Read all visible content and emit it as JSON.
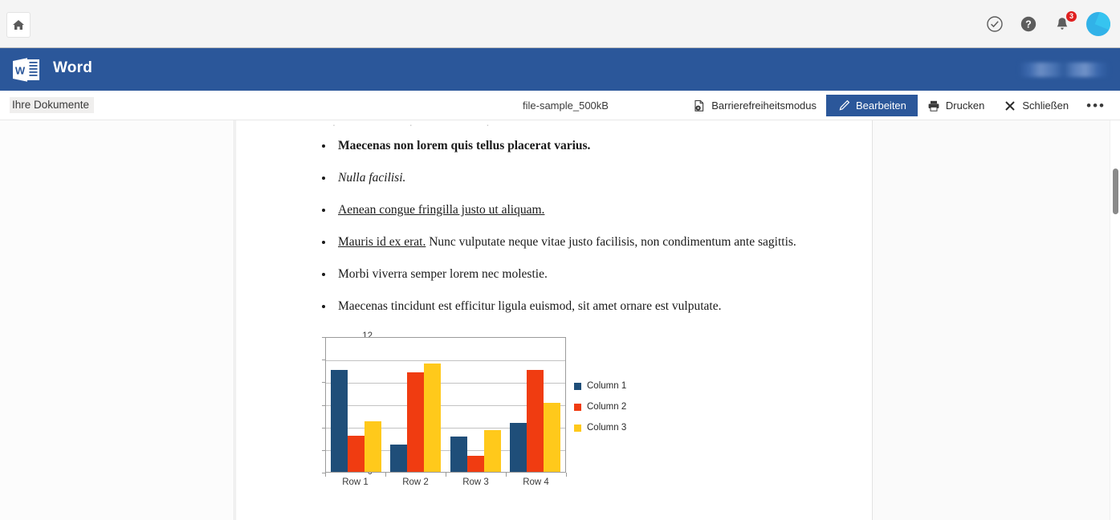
{
  "chrome": {
    "home_icon": "home-icon",
    "icons": [
      {
        "name": "check-circle-icon",
        "glyph": "check"
      },
      {
        "name": "help-circle-icon",
        "glyph": "question"
      },
      {
        "name": "notification-bell-icon",
        "glyph": "bell",
        "badge": "3"
      }
    ],
    "avatar": "user-avatar"
  },
  "header": {
    "app_name": "Word",
    "logo_letter": "W"
  },
  "command_bar": {
    "breadcrumb": "Ihre Dokumente",
    "document_name": "file-sample_500kB",
    "actions": [
      {
        "name": "accessibility-mode-button",
        "label": "Barrierefreiheitsmodus",
        "icon": "accessibility-doc-icon",
        "primary": false
      },
      {
        "name": "edit-button",
        "label": "Bearbeiten",
        "icon": "pencil-icon",
        "primary": true
      },
      {
        "name": "print-button",
        "label": "Drucken",
        "icon": "printer-icon",
        "primary": false
      },
      {
        "name": "close-button",
        "label": "Schließen",
        "icon": "close-icon",
        "primary": false
      }
    ],
    "overflow_label": "•••"
  },
  "document": {
    "bullets": [
      {
        "style": "bold",
        "text": "Maecenas non lorem quis tellus placerat varius."
      },
      {
        "style": "italic",
        "text": "Nulla facilisi."
      },
      {
        "style": "underline",
        "text": "Aenean congue fringilla justo ut aliquam."
      },
      {
        "style": "lead-underline",
        "lead": "Mauris id ex erat.",
        "text": " Nunc vulputate neque vitae justo facilisis, non condimentum ante sagittis."
      },
      {
        "style": "normal",
        "text": "Morbi viverra semper lorem nec molestie."
      },
      {
        "style": "normal",
        "text": "Maecenas tincidunt est efficitur ligula euismod, sit amet ornare est vulputate."
      }
    ]
  },
  "chart_data": {
    "type": "bar",
    "title": "",
    "xlabel": "",
    "ylabel": "",
    "categories": [
      "Row 1",
      "Row 2",
      "Row 3",
      "Row 4"
    ],
    "series": [
      {
        "name": "Column 1",
        "color": "#1F4E79",
        "values": [
          9.05,
          2.4,
          3.1,
          4.3
        ]
      },
      {
        "name": "Column 2",
        "color": "#F03C11",
        "values": [
          3.2,
          8.8,
          1.45,
          9.0
        ]
      },
      {
        "name": "Column 3",
        "color": "#FFC91B",
        "values": [
          4.5,
          9.6,
          3.7,
          6.1
        ]
      }
    ],
    "ylim": [
      0,
      12
    ],
    "yticks": [
      0,
      2,
      4,
      6,
      8,
      10,
      12
    ],
    "grid": true,
    "legend_position": "right"
  },
  "colors": {
    "brand_blue": "#2b579a",
    "badge_red": "#e02020",
    "avatar_blue": "#31b2e8"
  }
}
